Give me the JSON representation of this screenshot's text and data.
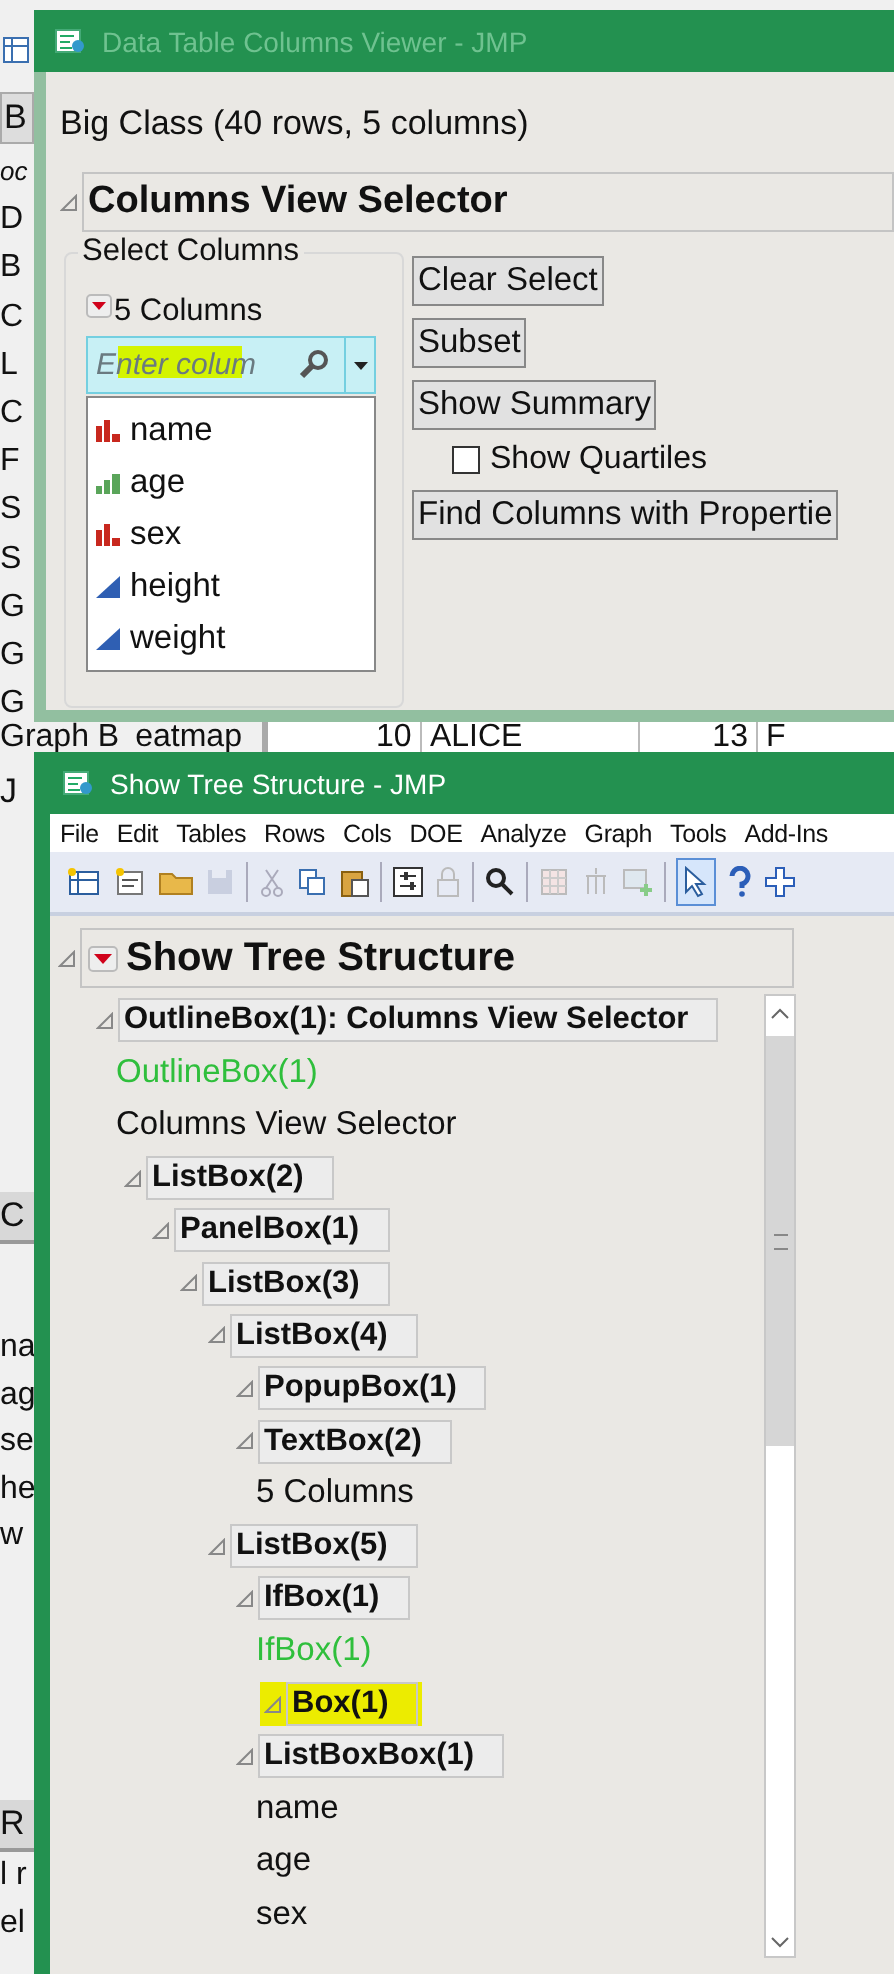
{
  "background_app": {
    "tab_fragment": "B",
    "list_fragments": [
      "oc",
      "D",
      "B",
      "C",
      "L",
      "C",
      "F",
      "S",
      "S",
      "G",
      "G",
      "G"
    ],
    "row_label_fragments": [
      "Graph B",
      "eatmap"
    ],
    "table_row": [
      "10",
      "ALICE",
      "13",
      "F"
    ],
    "app_fragment": "J",
    "section_fragment": "C",
    "column_fragments": [
      "na",
      "ag",
      "se",
      "he",
      "w"
    ],
    "rows_fragment": "R",
    "rows_fragments": [
      "l r",
      "el"
    ]
  },
  "columns_viewer": {
    "title": "Data Table Columns Viewer - JMP",
    "table_summary": "Big Class (40 rows, 5 columns)",
    "outline_title": "Columns View Selector",
    "panel_title": "Select Columns",
    "column_count": "5 Columns",
    "search": {
      "placeholder": "Enter colum",
      "highlighted": true
    },
    "columns": [
      {
        "name": "name",
        "kind": "nominal"
      },
      {
        "name": "age",
        "kind": "ordinal"
      },
      {
        "name": "sex",
        "kind": "nominal"
      },
      {
        "name": "height",
        "kind": "continuous"
      },
      {
        "name": "weight",
        "kind": "continuous"
      }
    ],
    "controls": [
      {
        "kind": "button",
        "label": "Clear Select"
      },
      {
        "kind": "button",
        "label": "Subset"
      },
      {
        "kind": "button",
        "label": "Show Summary"
      },
      {
        "kind": "checkbox",
        "label": "Show Quartiles",
        "checked": false
      },
      {
        "kind": "button",
        "label": "Find Columns with Propertie"
      }
    ]
  },
  "tree_window": {
    "title": "Show Tree Structure - JMP",
    "menu": [
      "File",
      "Edit",
      "Tables",
      "Rows",
      "Cols",
      "DOE",
      "Analyze",
      "Graph",
      "Tools",
      "Add-Ins"
    ],
    "report_title": "Show Tree Structure",
    "tree": [
      {
        "kind": "node",
        "label": "OutlineBox(1): Columns View Selector",
        "highlighted": false,
        "children": [
          {
            "kind": "green_text",
            "label": "OutlineBox(1)"
          },
          {
            "kind": "text",
            "label": "Columns View Selector"
          },
          {
            "kind": "node",
            "label": "ListBox(2)",
            "highlighted": false,
            "children": [
              {
                "kind": "node",
                "label": "PanelBox(1)",
                "highlighted": false,
                "children": [
                  {
                    "kind": "node",
                    "label": "ListBox(3)",
                    "highlighted": false,
                    "children": [
                      {
                        "kind": "node",
                        "label": "ListBox(4)",
                        "highlighted": false,
                        "children": [
                          {
                            "kind": "node",
                            "label": "PopupBox(1)",
                            "highlighted": false
                          },
                          {
                            "kind": "node",
                            "label": "TextBox(2)",
                            "highlighted": false,
                            "children": [
                              {
                                "kind": "text",
                                "label": "5 Columns"
                              }
                            ]
                          }
                        ]
                      },
                      {
                        "kind": "node",
                        "label": "ListBox(5)",
                        "highlighted": false,
                        "children": [
                          {
                            "kind": "node",
                            "label": "IfBox(1)",
                            "highlighted": false,
                            "children": [
                              {
                                "kind": "green_text",
                                "label": "IfBox(1)"
                              },
                              {
                                "kind": "node",
                                "label": "Box(1)",
                                "highlighted": true
                              }
                            ]
                          },
                          {
                            "kind": "node",
                            "label": "ListBoxBox(1)",
                            "highlighted": false,
                            "children": [
                              {
                                "kind": "text",
                                "label": "name"
                              },
                              {
                                "kind": "text",
                                "label": "age"
                              },
                              {
                                "kind": "text",
                                "label": "sex"
                              }
                            ]
                          }
                        ]
                      }
                    ]
                  }
                ]
              }
            ]
          }
        ]
      }
    ]
  }
}
